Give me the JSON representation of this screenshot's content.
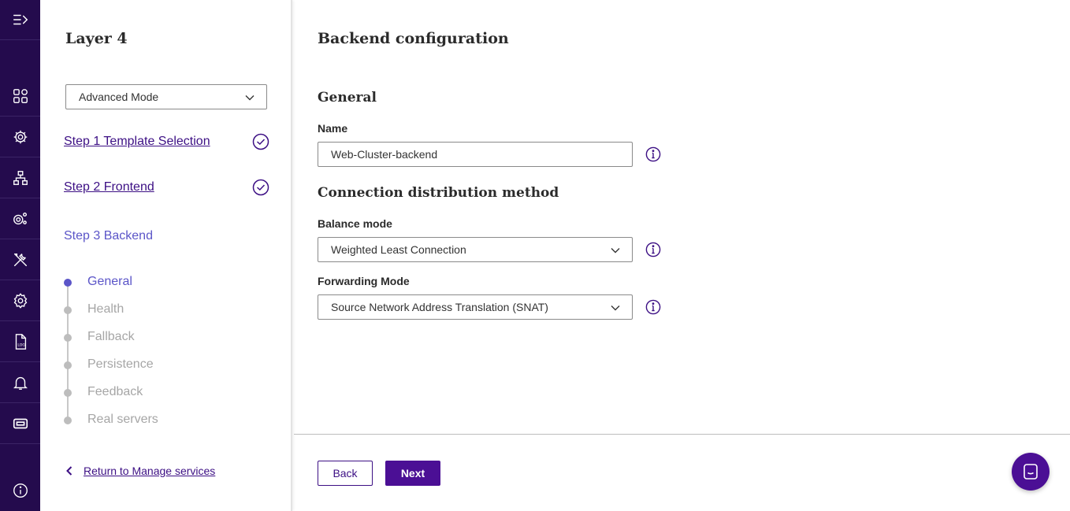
{
  "colors": {
    "rail_bg": "#240b4d",
    "accent": "#4b0f95",
    "link": "#3c0f84",
    "current_step": "#5b55c8",
    "inactive_step": "#a6a6a6"
  },
  "rail": {
    "items": [
      {
        "icon": "expand-menu-icon"
      },
      {
        "icon": "dashboard-icon"
      },
      {
        "icon": "services-icon"
      },
      {
        "icon": "network-icon"
      },
      {
        "icon": "system-settings-icon"
      },
      {
        "icon": "tools-icon"
      },
      {
        "icon": "settings-icon"
      },
      {
        "icon": "log-icon"
      },
      {
        "icon": "notifications-icon"
      },
      {
        "icon": "license-icon"
      }
    ],
    "bottom_icon": "info-icon"
  },
  "steps_panel": {
    "title": "Layer 4",
    "mode_select": {
      "value": "Advanced Mode"
    },
    "steps": [
      {
        "label": "Step 1 Template Selection",
        "completed": true
      },
      {
        "label": "Step 2 Frontend",
        "completed": true
      }
    ],
    "current_step": "Step 3 Backend",
    "substeps": [
      {
        "label": "General",
        "active": true
      },
      {
        "label": "Health",
        "active": false
      },
      {
        "label": "Fallback",
        "active": false
      },
      {
        "label": "Persistence",
        "active": false
      },
      {
        "label": "Feedback",
        "active": false
      },
      {
        "label": "Real servers",
        "active": false
      }
    ],
    "return_link": "Return to Manage services"
  },
  "main": {
    "title": "Backend configuration",
    "general": {
      "heading": "General",
      "name_label": "Name",
      "name_value": "Web-Cluster-backend"
    },
    "distribution": {
      "heading": "Connection distribution method",
      "balance_label": "Balance mode",
      "balance_value": "Weighted Least Connection",
      "forwarding_label": "Forwarding Mode",
      "forwarding_value": "Source Network Address Translation (SNAT)"
    },
    "footer": {
      "back_label": "Back",
      "next_label": "Next"
    }
  }
}
